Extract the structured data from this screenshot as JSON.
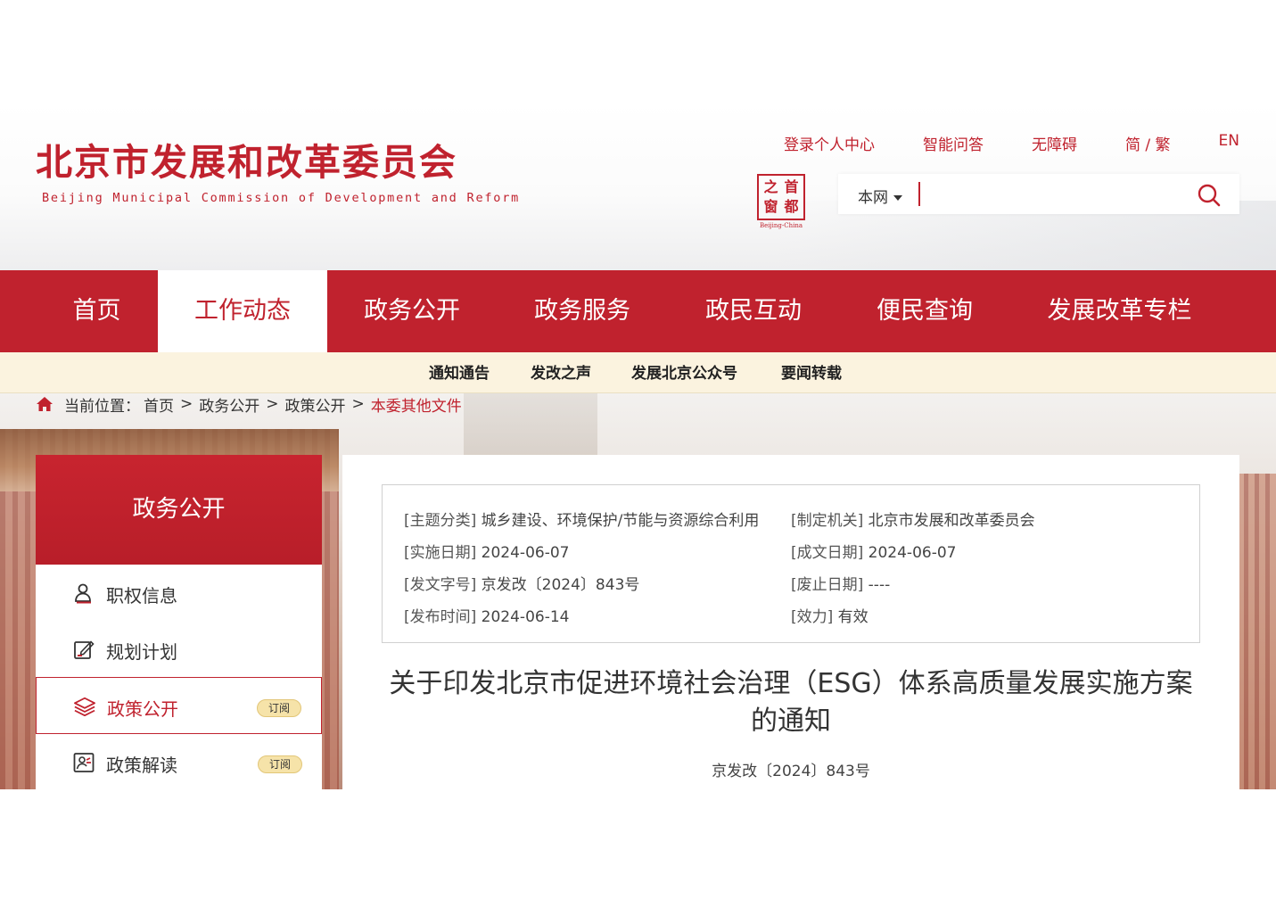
{
  "header": {
    "title": "北京市发展和改革委员会",
    "subtitle": "Beijing Municipal Commission of Development and Reform",
    "top_links": {
      "login": "登录个人中心",
      "qa": "智能问答",
      "accessibility": "无障碍",
      "language": "简 / 繁",
      "english": "EN"
    },
    "capital_logo": {
      "chars": [
        "之",
        "首",
        "窗",
        "都"
      ],
      "caption": "Beijing-China"
    },
    "search": {
      "scope": "本网",
      "placeholder": ""
    }
  },
  "main_nav": {
    "items": [
      "首页",
      "工作动态",
      "政务公开",
      "政务服务",
      "政民互动",
      "便民查询",
      "发展改革专栏"
    ],
    "active_index": 1
  },
  "sub_nav": {
    "items": [
      "通知通告",
      "发改之声",
      "发展北京公众号",
      "要闻转载"
    ]
  },
  "breadcrumb": {
    "label": "当前位置：",
    "items": [
      "首页",
      "政务公开",
      "政策公开"
    ],
    "separator": ">",
    "current": "本委其他文件"
  },
  "sidebar": {
    "heading": "政务公开",
    "items": [
      {
        "label": "职权信息",
        "icon": "person-icon"
      },
      {
        "label": "规划计划",
        "icon": "edit-document-icon"
      },
      {
        "label": "政策公开",
        "icon": "layers-icon",
        "badge": "订阅"
      },
      {
        "label": "政策解读",
        "icon": "reading-person-icon",
        "badge": "订阅"
      }
    ],
    "active_index": 2
  },
  "document": {
    "meta": {
      "topic": {
        "k": "[主题分类]",
        "v": "城乡建设、环境保护/节能与资源综合利用"
      },
      "issuer": {
        "k": "[制定机关]",
        "v": "北京市发展和改革委员会"
      },
      "effective_date": {
        "k": "[实施日期]",
        "v": "2024-06-07"
      },
      "written_date": {
        "k": "[成文日期]",
        "v": "2024-06-07"
      },
      "doc_no": {
        "k": "[发文字号]",
        "v": "京发改〔2024〕843号"
      },
      "expiry_date": {
        "k": "[废止日期]",
        "v": "----"
      },
      "publish_time": {
        "k": "[发布时间]",
        "v": "2024-06-14"
      },
      "validity": {
        "k": "[效力]",
        "v": "有效"
      }
    },
    "title": "关于印发北京市促进环境社会治理（ESG）体系高质量发展实施方案的通知",
    "number": "京发改〔2024〕843号"
  },
  "colors": {
    "brand_red": "#c0222e",
    "subnav_bg": "#fbf3df",
    "badge_bg": "#f6e3a9"
  }
}
